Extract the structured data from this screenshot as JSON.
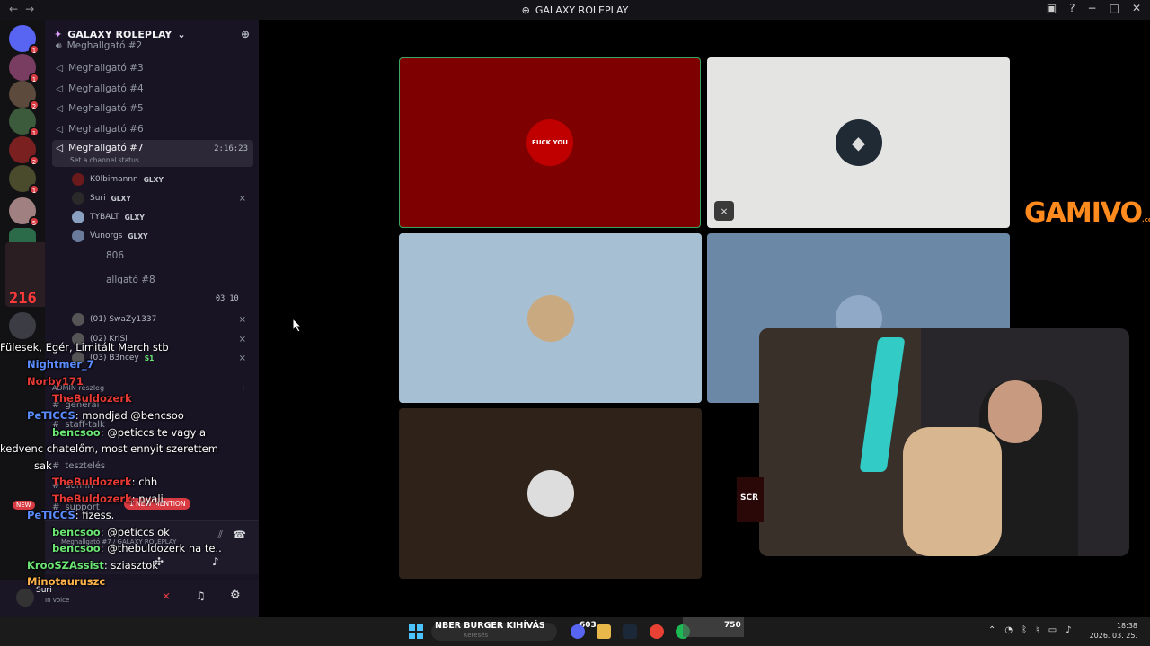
{
  "titlebar": {
    "title": "GALAXY ROLEPLAY"
  },
  "guild": {
    "name": "GALAXY ROLEPLAY"
  },
  "channels": [
    {
      "name": "Meghallgató #2"
    },
    {
      "name": "Meghallgató #3"
    },
    {
      "name": "Meghallgató #4"
    },
    {
      "name": "Meghallgató #5"
    },
    {
      "name": "Meghallgató #6"
    },
    {
      "name": "Meghallgató #7",
      "time": "2:16:23",
      "status": "Set a channel status"
    }
  ],
  "voice_users": [
    {
      "name": "K0lbimannn",
      "tag": "GLXY"
    },
    {
      "name": "Suri",
      "tag": "GLXY"
    },
    {
      "name": "TYBALT",
      "tag": "GLXY"
    },
    {
      "name": "Vunorgs",
      "tag": "GLXY"
    }
  ],
  "channel_806": "806",
  "channel_8": "allgató #8",
  "channel_8_counts": "03  10",
  "voice_users_2": [
    {
      "name": "(01) SwaZy1337"
    },
    {
      "name": "(02) KriSi"
    },
    {
      "name": "(03) B3ncey",
      "tag": "S1"
    }
  ],
  "category": "ADMIN részleg",
  "text_channels": [
    "general",
    "staff-talk",
    "tesztelés",
    "admin",
    "support"
  ],
  "mention": "1 NEW MENTION",
  "new_label": "NEW",
  "counter": "216",
  "voice_panel": {
    "channel": "Meghallgató #7 / GALAXY ROLEPLAY"
  },
  "user_panel": {
    "name": "Suri",
    "status": "In voice"
  },
  "chat": [
    {
      "name": "",
      "msg": "Fülesek, Egér, Limitált Merch stb"
    },
    {
      "name": "Nightmer_7",
      "msg": ""
    },
    {
      "name": "Norby171",
      "msg": ""
    },
    {
      "name": "TheBuldozerk",
      "msg": ""
    },
    {
      "name": "PeTICCS",
      "msg": ": mondjad @bencsoo"
    },
    {
      "name": "bencsoo",
      "msg": ": @peticcs te vagy a"
    },
    {
      "name": "",
      "msg": "kedvenc chatelőm, most ennyit szerettem"
    },
    {
      "name": "",
      "msg": "sak"
    },
    {
      "name": "TheBuldozerk",
      "msg": ": chh"
    },
    {
      "name": "TheBuldozerk",
      "msg": ": nyali"
    },
    {
      "name": "PeTICCS",
      "msg": ": fizess."
    },
    {
      "name": "bencsoo",
      "msg": ": @peticcs ok"
    },
    {
      "name": "bencsoo",
      "msg": ": @thebuldozerk na te.."
    },
    {
      "name": "KrooSZAssist",
      "msg": ": sziasztok"
    },
    {
      "name": "Minotauruszc",
      "msg": ""
    }
  ],
  "tiles": [
    {
      "label": "FUCK YOU"
    },
    {
      "label": ""
    },
    {
      "label": ""
    },
    {
      "label": ""
    },
    {
      "label": ""
    }
  ],
  "gamivo": {
    "text": "GAMIVO",
    "sub": ".com"
  },
  "taskbar": {
    "banner": "NBER BURGER KIHÍVÁS",
    "search_placeholder": "Keresés",
    "count_1": "603",
    "count_2": "750",
    "time": "18:38",
    "date": "2026. 03. 25."
  },
  "colors": {
    "accent": "#5865f2",
    "danger": "#d83a42",
    "gamivo": "#ff8a1e"
  }
}
